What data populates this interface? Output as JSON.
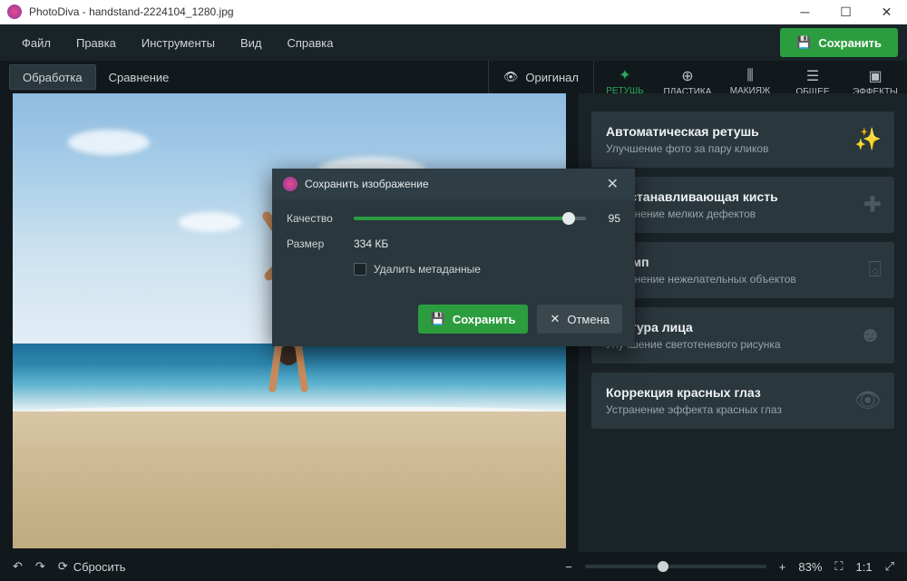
{
  "window": {
    "app_name": "PhotoDiva",
    "file_name": "handstand-2224104_1280.jpg"
  },
  "menu": {
    "items": [
      "Файл",
      "Правка",
      "Инструменты",
      "Вид",
      "Справка"
    ],
    "save_label": "Сохранить"
  },
  "viewtabs": {
    "edit": "Обработка",
    "compare": "Сравнение",
    "original": "Оригинал"
  },
  "tooltabs": [
    {
      "label": "РЕТУШЬ",
      "active": true
    },
    {
      "label": "ПЛАСТИКА",
      "active": false
    },
    {
      "label": "МАКИЯЖ",
      "active": false
    },
    {
      "label": "ОБЩЕЕ",
      "active": false
    },
    {
      "label": "ЭФФЕКТЫ",
      "active": false
    }
  ],
  "panels": [
    {
      "title": "Автоматическая ретушь",
      "desc": "Улучшение фото за пару кликов",
      "icon": "✨"
    },
    {
      "title": "Восстанавливающая кисть",
      "desc": "Устранение мелких дефектов",
      "icon": "✚"
    },
    {
      "title": "Штамп",
      "desc": "Устранение нежелательных объектов",
      "icon": "⌺"
    },
    {
      "title": "Фактура лица",
      "desc": "Улучшение светотеневого рисунка",
      "icon": "☻"
    },
    {
      "title": "Коррекция красных глаз",
      "desc": "Устранение эффекта красных глаз",
      "icon": "👁"
    }
  ],
  "bottombar": {
    "reset": "Сбросить",
    "zoom": "83%",
    "ratio": "1:1"
  },
  "dialog": {
    "title": "Сохранить изображение",
    "quality_label": "Качество",
    "quality_value": "95",
    "size_label": "Размер",
    "size_value": "334 КБ",
    "remove_meta_label": "Удалить метаданные",
    "save": "Сохранить",
    "cancel": "Отмена"
  }
}
